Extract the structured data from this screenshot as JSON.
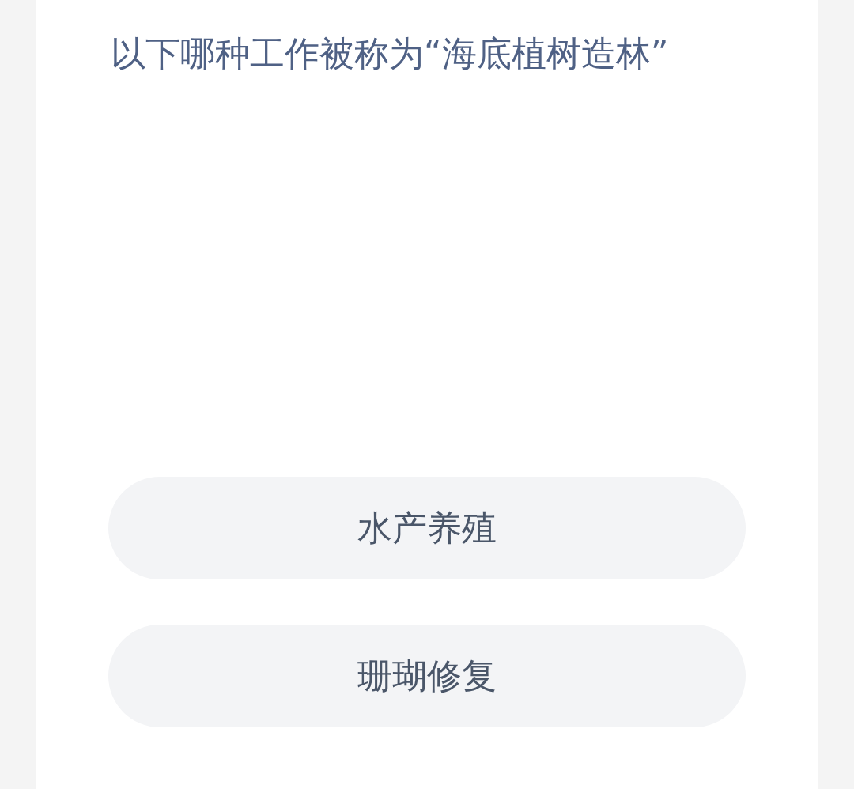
{
  "question": "以下哪种工作被称为“海底植树造林”",
  "options": [
    {
      "label": "水产养殖"
    },
    {
      "label": "珊瑚修复"
    }
  ]
}
